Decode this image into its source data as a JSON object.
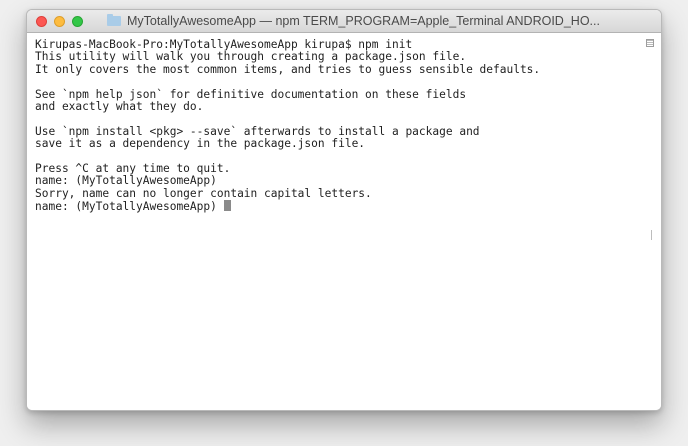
{
  "window": {
    "title": "MyTotallyAwesomeApp — npm TERM_PROGRAM=Apple_Terminal ANDROID_HO..."
  },
  "icons": {
    "close": "close-icon",
    "minimize": "minimize-icon",
    "zoom": "zoom-icon",
    "folder": "folder-icon",
    "scroll": "scroll-grip-icon"
  },
  "colors": {
    "close": "#fc5753",
    "minimize": "#fdbc40",
    "zoom": "#33c748",
    "terminal_bg": "#ffffff",
    "terminal_text": "#1f1f1f"
  },
  "terminal": {
    "lines": [
      "Kirupas-MacBook-Pro:MyTotallyAwesomeApp kirupa$ npm init",
      "This utility will walk you through creating a package.json file.",
      "It only covers the most common items, and tries to guess sensible defaults.",
      "",
      "See `npm help json` for definitive documentation on these fields",
      "and exactly what they do.",
      "",
      "Use `npm install <pkg> --save` afterwards to install a package and",
      "save it as a dependency in the package.json file.",
      "",
      "Press ^C at any time to quit.",
      "name: (MyTotallyAwesomeApp)",
      "Sorry, name can no longer contain capital letters.",
      "name: (MyTotallyAwesomeApp) "
    ]
  }
}
